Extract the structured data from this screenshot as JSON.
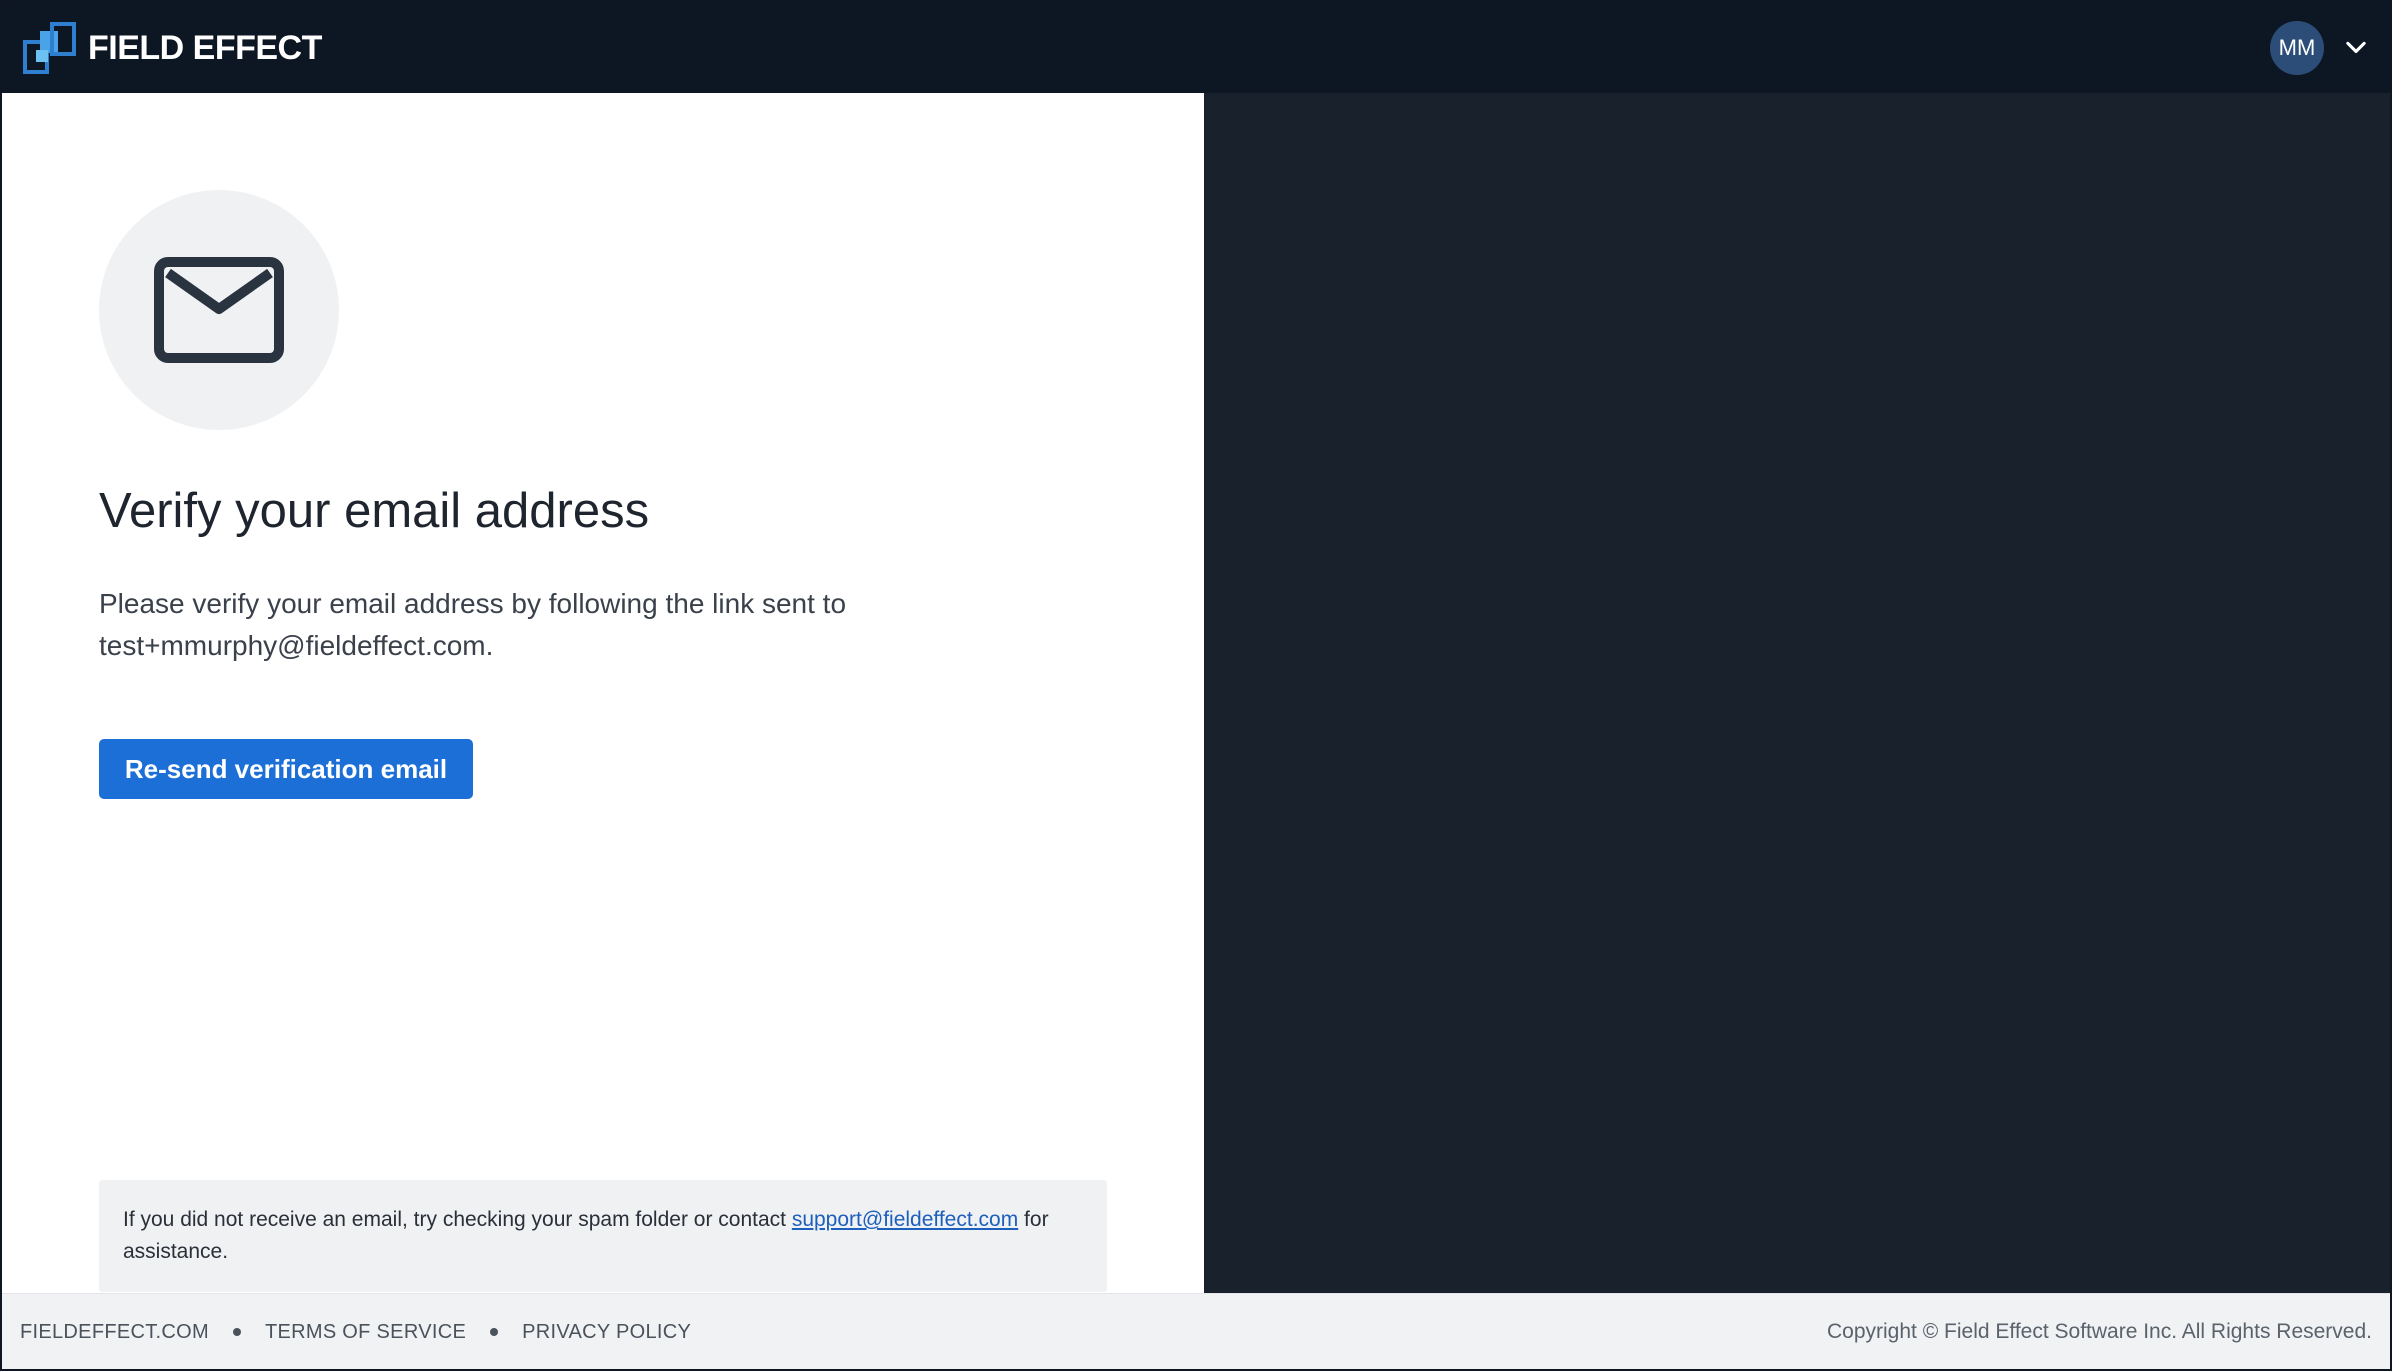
{
  "header": {
    "brand": "FIELD EFFECT",
    "user_initials": "MM",
    "colors": {
      "background": "#0d1724",
      "avatar": "#2b4d78"
    }
  },
  "main": {
    "icon": "mail-icon",
    "title": "Verify your email address",
    "description": "Please verify your email address by following the link sent to test+mmurphy@fieldeffect.com.",
    "resend_button_label": "Re-send verification email",
    "notice": {
      "text_before": "If you did not receive an email, try checking your spam folder or contact ",
      "link_text": "support@fieldeffect.com",
      "text_after": " for assistance."
    },
    "colors": {
      "button": "#1b6fd6",
      "right_panel": "#18212c"
    }
  },
  "footer": {
    "links": [
      "FIELDEFFECT.COM",
      "TERMS OF SERVICE",
      "PRIVACY POLICY"
    ],
    "copyright": "Copyright © Field Effect Software Inc. All Rights Reserved."
  }
}
